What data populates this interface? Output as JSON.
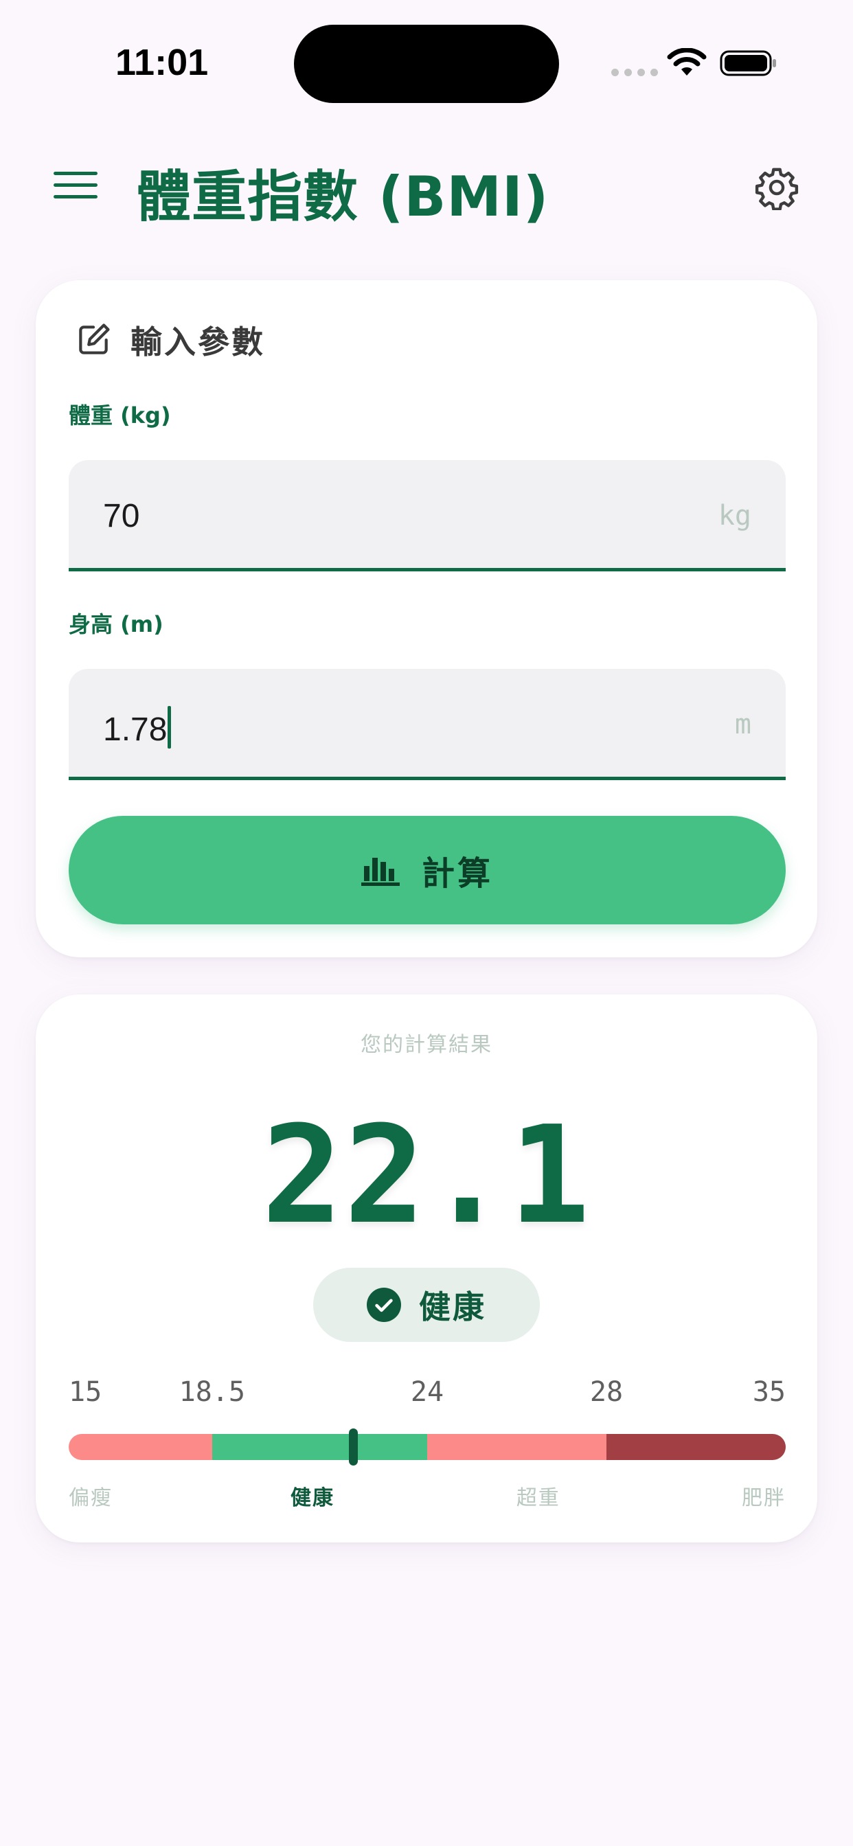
{
  "status_bar": {
    "time": "11:01"
  },
  "app_bar": {
    "title": "體重指數 (BMI)"
  },
  "input_card": {
    "title": "輸入參數",
    "weight": {
      "label": "體重 (kg)",
      "value": "70",
      "unit": "kg"
    },
    "height": {
      "label": "身高 (m)",
      "value": "1.78",
      "unit": "m"
    },
    "calculate_label": "計算"
  },
  "result_card": {
    "caption": "您的計算結果",
    "bmi": "22.1",
    "bmi_value": 22.1,
    "status": "健康",
    "scale": {
      "ticks": [
        "15",
        "18.5",
        "24",
        "28",
        "35"
      ],
      "tick_values": [
        15,
        18.5,
        24,
        28,
        35
      ],
      "categories": [
        "偏瘦",
        "健康",
        "超重",
        "肥胖"
      ],
      "active_category": 1,
      "colors": [
        "#fb8a88",
        "#45c186",
        "#fb8a88",
        "#a23f44"
      ]
    }
  },
  "colors": {
    "primary": "#0f6b45",
    "accent": "#45c186",
    "background": "#fcf7fd"
  }
}
